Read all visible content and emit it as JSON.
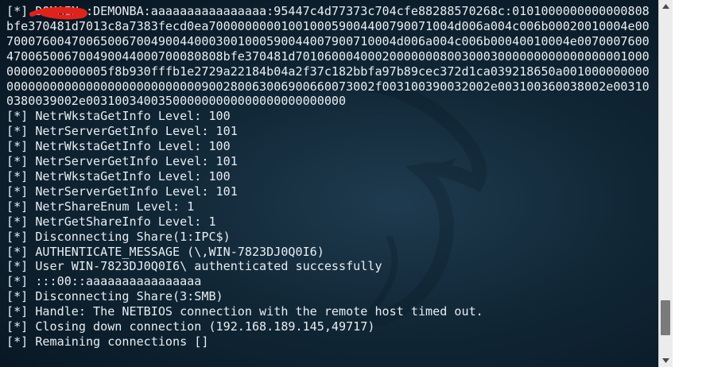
{
  "terminal": {
    "lines": [
      "[*] DOMAIN::DEMONBA:aaaaaaaaaaaaaaaa:95447c4d77373c704cfe88288570268c:0101000000000000808bfe370481d7013c8a7383fecd0ea7000000000100100059004400790071004d006a004c006b00020010004e00700076004700650067004900440003001000590044007900710004d006a004c006b00040010004e0070007600470065006700490044000700080808bfe370481d701060004000200000008003000300000000000000000100000000200000005f8b930fffb1e2729a22184b04a2f37c182bbfa97b89cec372d1ca039218650a001000000000000000000000000000000000000900280063006900660073002f003100390032002e003100360038002e003100380039002e003100340035000000000000000000000000",
      "[*] NetrWkstaGetInfo Level: 100",
      "[*] NetrServerGetInfo Level: 101",
      "[*] NetrWkstaGetInfo Level: 100",
      "[*] NetrServerGetInfo Level: 101",
      "[*] NetrWkstaGetInfo Level: 100",
      "[*] NetrServerGetInfo Level: 101",
      "[*] NetrShareEnum Level: 1",
      "[*] NetrGetShareInfo Level: 1",
      "[*] Disconnecting Share(1:IPC$)",
      "[*] AUTHENTICATE_MESSAGE (\\,WIN-7823DJ0Q0I6)",
      "[*] User WIN-7823DJ0Q0I6\\ authenticated successfully",
      "[*] :::00::aaaaaaaaaaaaaaaa",
      "[*] Disconnecting Share(3:SMB)",
      "[*] Handle: The NETBIOS connection with the remote host timed out.",
      "[*] Closing down connection (192.168.189.145,49717)",
      "[*] Remaining connections []"
    ]
  },
  "colors": {
    "terminal_text": "#e8eef2",
    "terminal_bg": "#0c1d2a",
    "redaction_mark": "#e0221b",
    "scroll_thumb": "#7a7a7a"
  },
  "icons": {
    "watermark": "kali-dragon-icon",
    "scroll_up": "triangle-up-icon",
    "scroll_down": "triangle-down-icon"
  }
}
